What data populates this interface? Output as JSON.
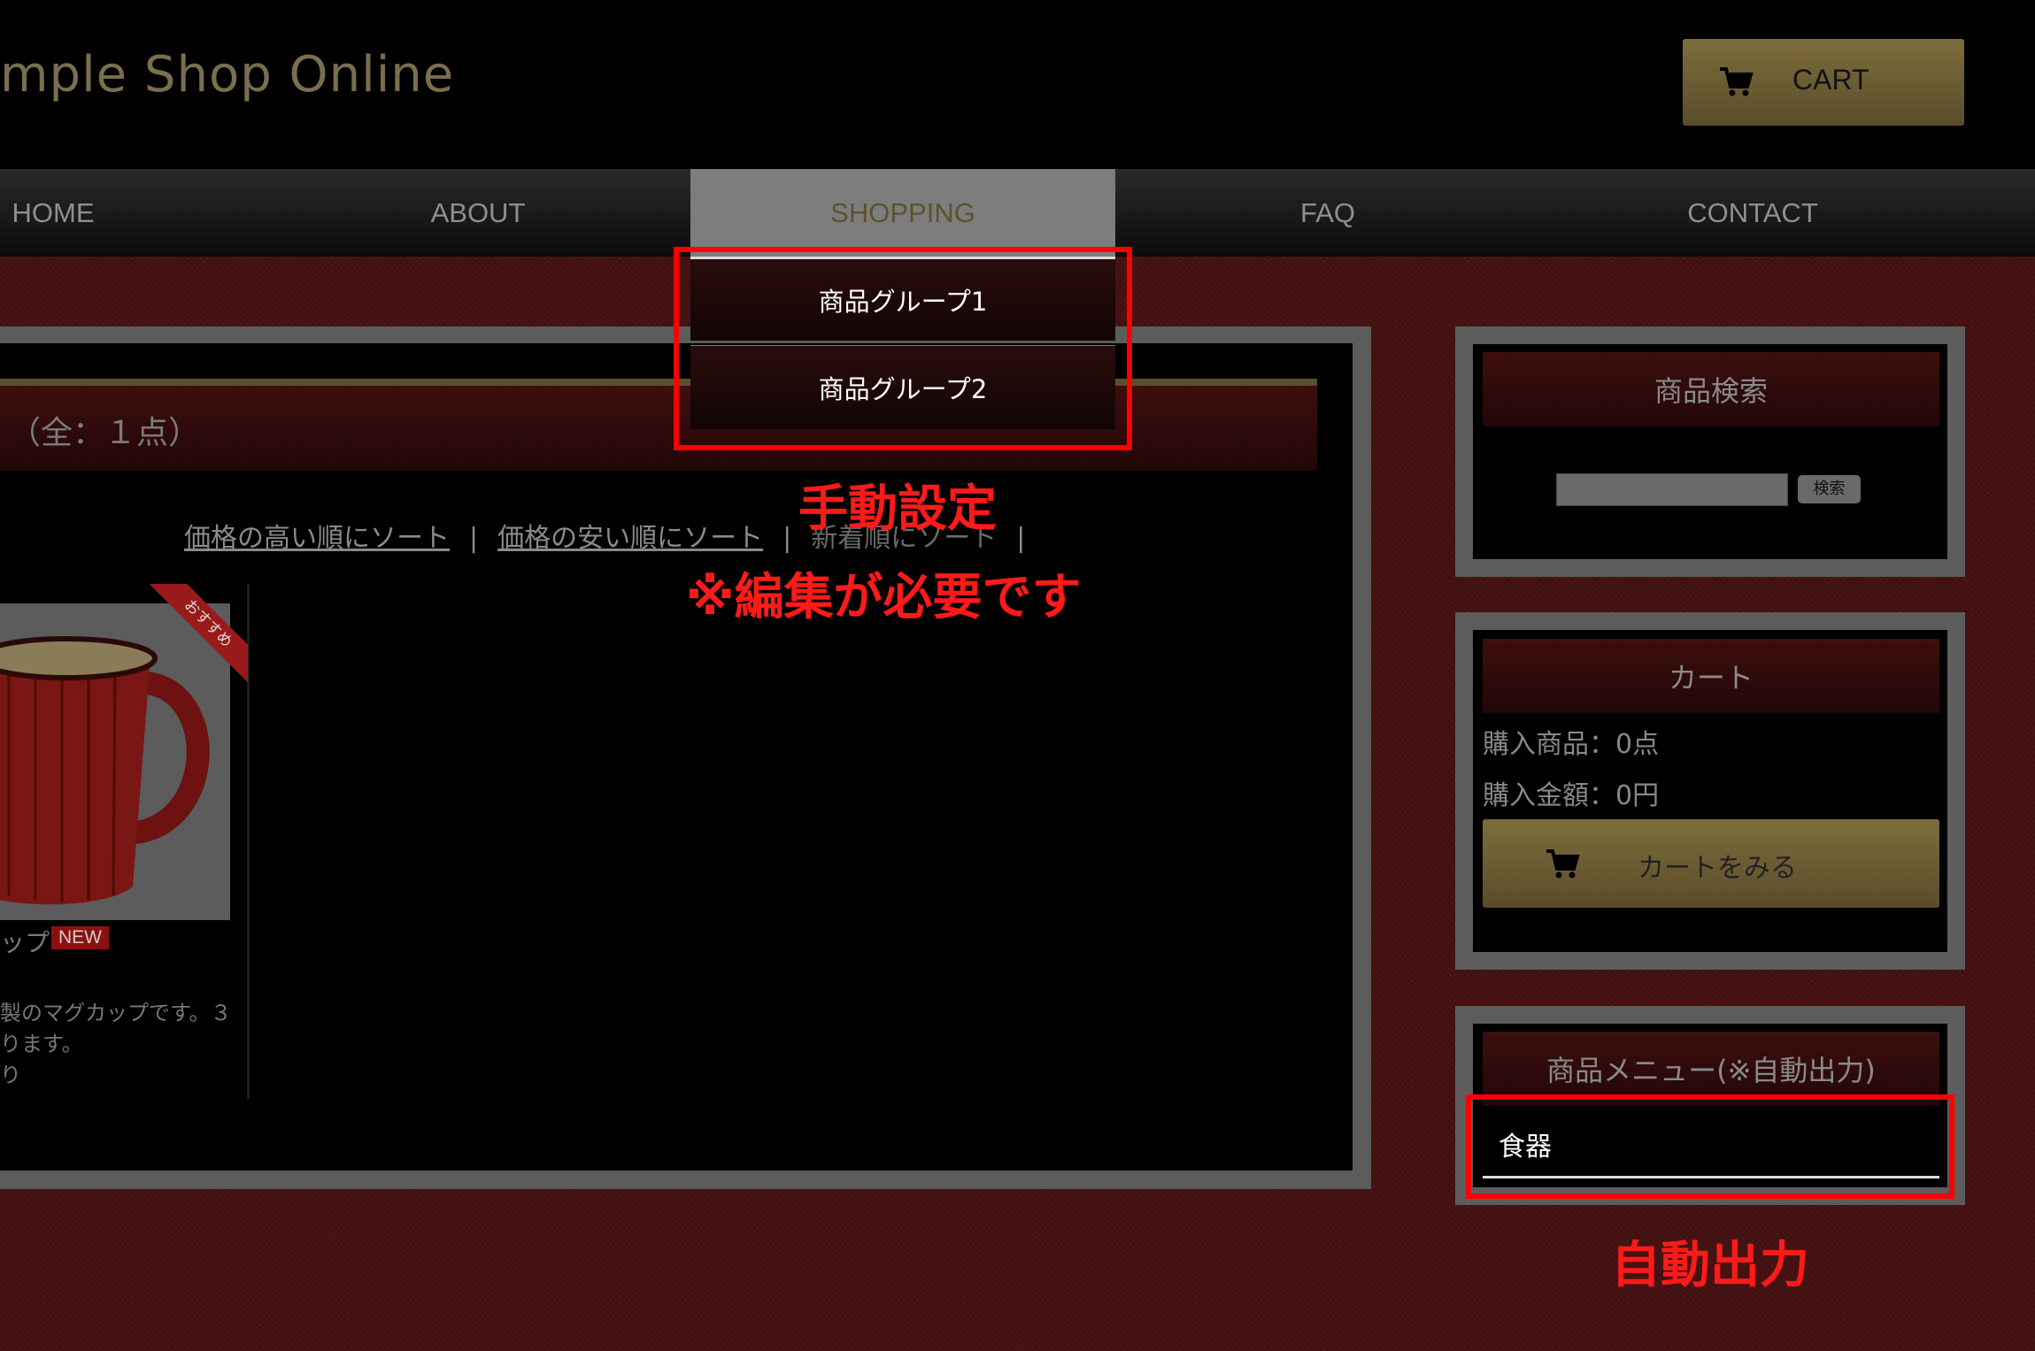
{
  "header": {
    "shop_title": "mple Shop Online",
    "cart_label": "CART"
  },
  "nav": {
    "items": [
      {
        "label": "HOME"
      },
      {
        "label": "ABOUT"
      },
      {
        "label": "SHOPPING"
      },
      {
        "label": "FAQ"
      },
      {
        "label": "CONTACT"
      }
    ],
    "active": "SHOPPING"
  },
  "dropdown": {
    "items": [
      {
        "label": "商品グループ1"
      },
      {
        "label": "商品グループ2"
      }
    ]
  },
  "main": {
    "list_count": "（全：１点）",
    "sort": {
      "high": "価格の高い順にソート",
      "sep": "|",
      "low": "価格の安い順にソート",
      "new": "新着順にソート"
    },
    "product": {
      "ribbon": "おすすめ",
      "name": "ップ",
      "badge": "NEW",
      "desc": "製のマグカップです。３\nります。\nり"
    }
  },
  "sidebar": {
    "search": {
      "title": "商品検索",
      "button": "検索",
      "value": ""
    },
    "cart": {
      "title": "カート",
      "items_line": "購入商品：0点",
      "amount_line": "購入金額：0円",
      "view_button": "カートをみる"
    },
    "menu": {
      "title": "商品メニュー(※自動出力)",
      "items": [
        {
          "label": "食器"
        }
      ]
    }
  },
  "annotations": {
    "manual": "手動設定",
    "manual_note": "※編集が必要です",
    "auto": "自動出力",
    "color": "#ff0000"
  }
}
